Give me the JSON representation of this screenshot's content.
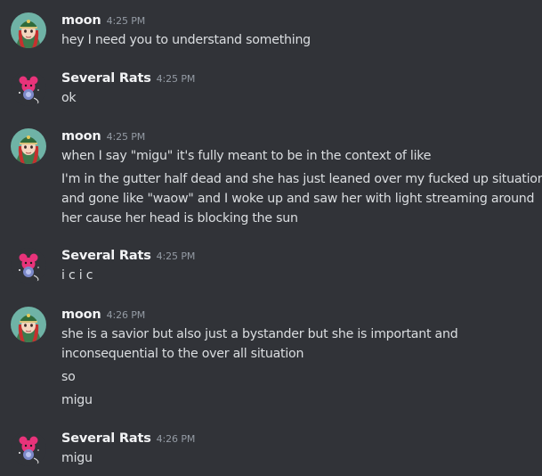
{
  "users": {
    "moon": {
      "name": "moon",
      "avatar_icon": "moon-avatar-icon"
    },
    "rats": {
      "name": "Several Rats",
      "avatar_icon": "rat-avatar-icon"
    }
  },
  "colors": {
    "background": "#313338",
    "author": "#f2f3f5",
    "text": "#dbdee1",
    "timestamp": "#949ba4"
  },
  "messages": [
    {
      "author": "moon",
      "time": "4:25 PM",
      "lines": [
        "hey I need you to understand something"
      ]
    },
    {
      "author": "Several Rats",
      "time": "4:25 PM",
      "lines": [
        "ok"
      ]
    },
    {
      "author": "moon",
      "time": "4:25 PM",
      "lines": [
        "when I say \"migu\" it's fully meant to be in the context of like",
        "I'm in the gutter half dead and she has just leaned over my fucked up situation",
        "and gone like \"waow\" and I woke up and saw her with light streaming around",
        "her cause her head is blocking the sun"
      ]
    },
    {
      "author": "Several Rats",
      "time": "4:25 PM",
      "lines": [
        "i c i c"
      ]
    },
    {
      "author": "moon",
      "time": "4:26 PM",
      "lines": [
        "she is a savior but also just a bystander but she is important and",
        "inconsequential to the over all situation",
        "so",
        "migu"
      ]
    },
    {
      "author": "Several Rats",
      "time": "4:26 PM",
      "lines": [
        "migu"
      ]
    }
  ]
}
